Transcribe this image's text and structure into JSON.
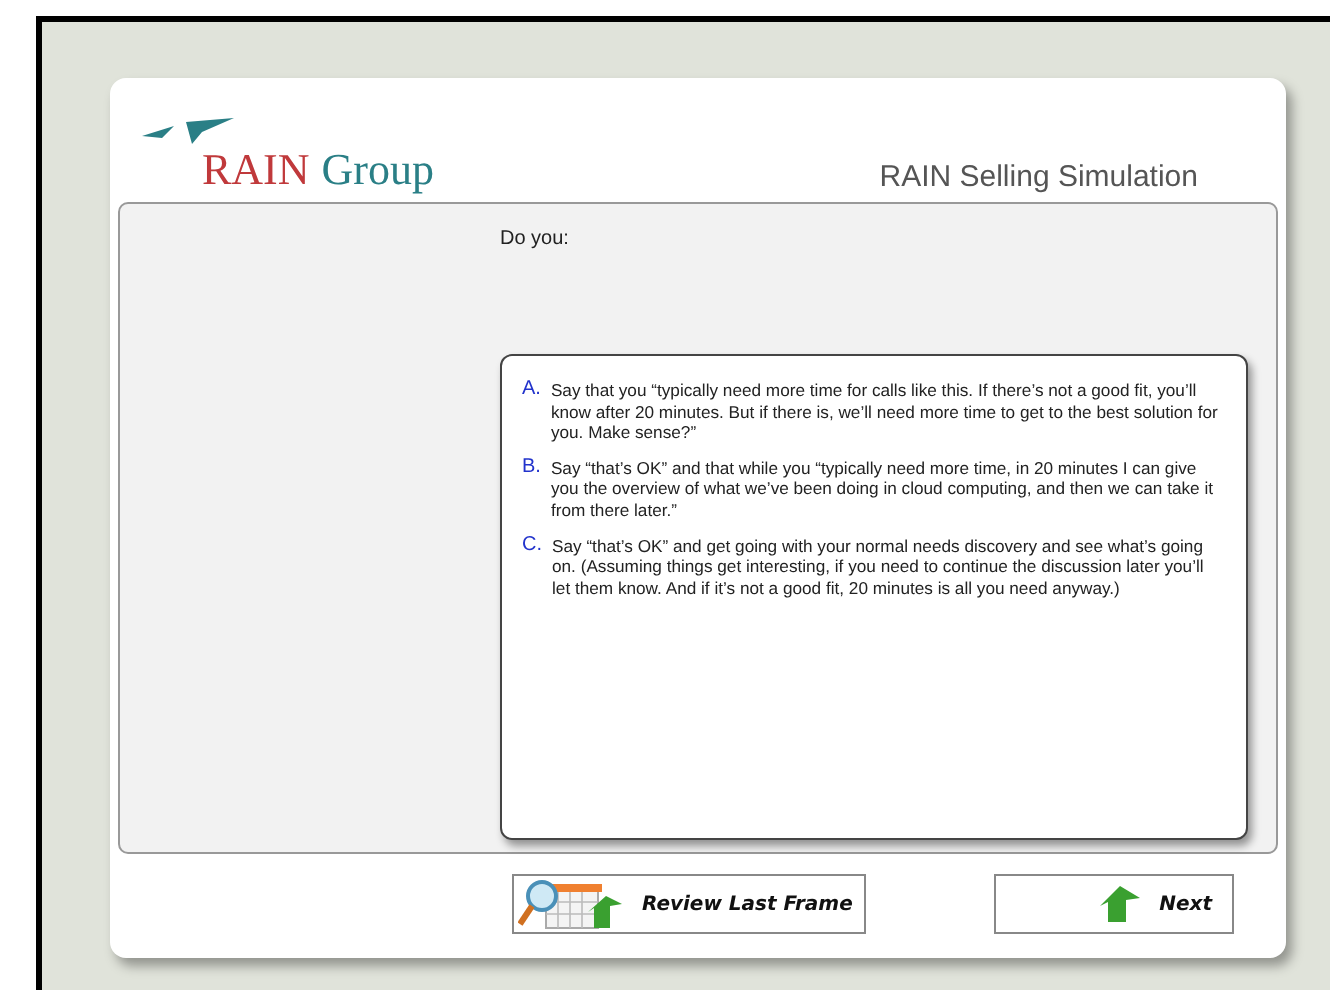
{
  "logo": {
    "primary": "RAIN",
    "secondary": "Group"
  },
  "title": "RAIN Selling Simulation",
  "prompt": "Do you:",
  "options": [
    {
      "letter": "A.",
      "text": "Say that you “typically need more time for calls like this. If there’s not a good fit, you’ll know after 20 minutes. But if there is, we’ll need more time to get to the best solution for you. Make sense?”"
    },
    {
      "letter": "B.",
      "text": "Say “that’s OK” and that while you “typically need more time, in 20 minutes I can give you the overview of what we’ve been doing in cloud computing, and then we can take it from there later.”"
    },
    {
      "letter": "C.",
      "text": "Say “that’s OK” and get going with your normal needs discovery and see what’s going on. (Assuming things get interesting, if you need to continue the discussion later you’ll let them know. And if it’s not a good fit, 20 minutes is all you need anyway.)"
    }
  ],
  "buttons": [
    {
      "kind": "review",
      "label": "Review Last Frame"
    },
    {
      "kind": "next",
      "label": "Next"
    }
  ]
}
